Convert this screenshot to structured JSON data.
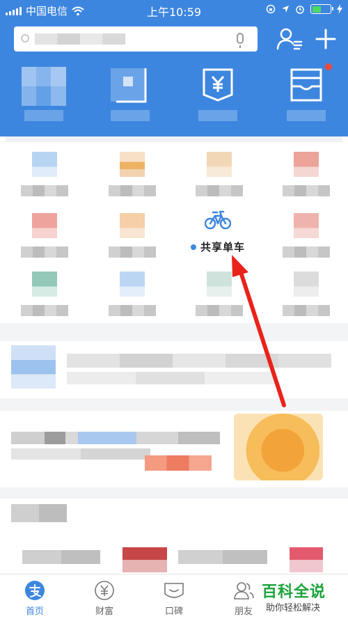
{
  "status_bar": {
    "carrier": "中国电信",
    "time": "上午10:59"
  },
  "icons": {
    "contacts": "contacts-icon",
    "add": "add-icon",
    "yuan": "yuan-icon",
    "bike": "bike-icon"
  },
  "colors": {
    "header_blue": "#3d86df",
    "arrow_red": "#e8231b",
    "watermark_green": "#1ba33b",
    "battery_green": "#4cd964"
  },
  "featured_app": {
    "label": "共享单车"
  },
  "tabbar": {
    "items": [
      {
        "label": "首页",
        "active": true
      },
      {
        "label": "财富"
      },
      {
        "label": "口碑"
      },
      {
        "label": "朋友"
      }
    ]
  },
  "watermark": {
    "title": "百科全说",
    "subtitle": "助你轻松解决"
  }
}
